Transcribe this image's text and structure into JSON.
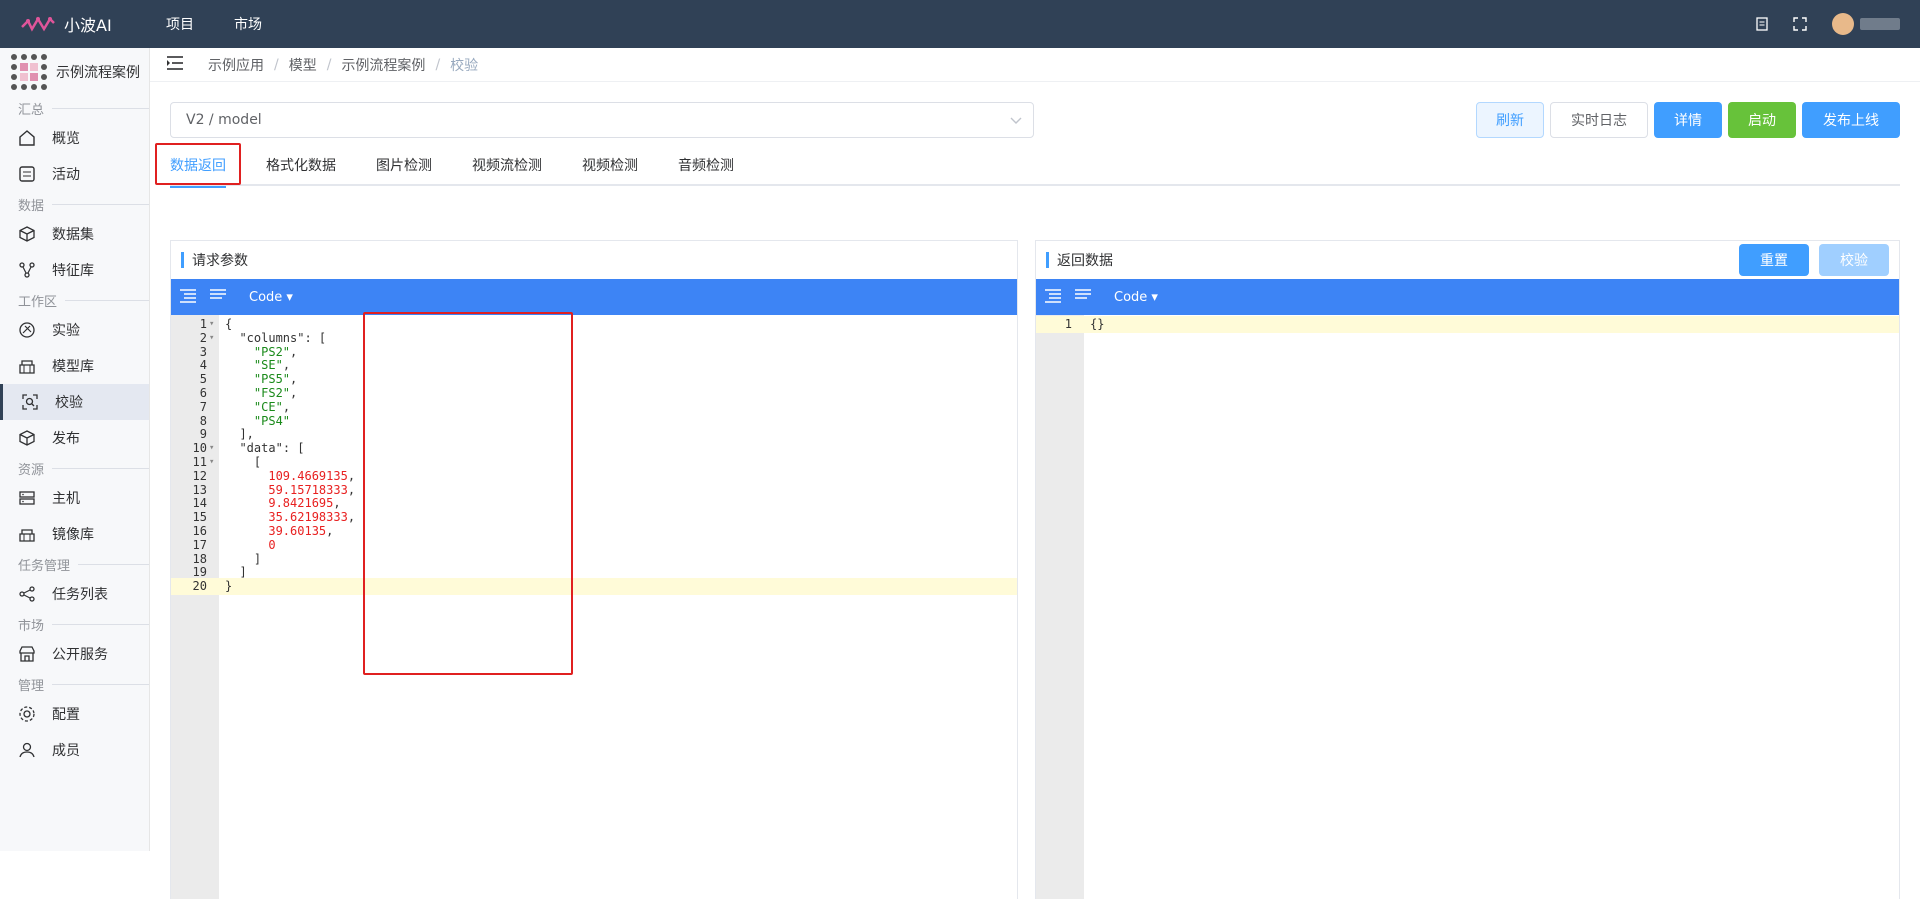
{
  "header": {
    "app_name": "小波AI",
    "nav": [
      "项目",
      "市场"
    ]
  },
  "sidebar": {
    "project_name": "示例流程案例",
    "sections": [
      {
        "title": "汇总",
        "items": [
          {
            "label": "概览",
            "icon": "home-icon"
          },
          {
            "label": "活动",
            "icon": "activity-icon"
          }
        ]
      },
      {
        "title": "数据",
        "items": [
          {
            "label": "数据集",
            "icon": "cube-icon"
          },
          {
            "label": "特征库",
            "icon": "feature-icon"
          }
        ]
      },
      {
        "title": "工作区",
        "items": [
          {
            "label": "实验",
            "icon": "experiment-icon"
          },
          {
            "label": "模型库",
            "icon": "model-icon"
          },
          {
            "label": "校验",
            "icon": "verify-icon",
            "active": true
          },
          {
            "label": "发布",
            "icon": "box-icon"
          }
        ]
      },
      {
        "title": "资源",
        "items": [
          {
            "label": "主机",
            "icon": "server-icon"
          },
          {
            "label": "镜像库",
            "icon": "image-repo-icon"
          }
        ]
      },
      {
        "title": "任务管理",
        "items": [
          {
            "label": "任务列表",
            "icon": "share-icon"
          }
        ]
      },
      {
        "title": "市场",
        "items": [
          {
            "label": "公开服务",
            "icon": "store-icon"
          }
        ]
      },
      {
        "title": "管理",
        "items": [
          {
            "label": "配置",
            "icon": "gear-icon"
          },
          {
            "label": "成员",
            "icon": "user-icon"
          }
        ]
      }
    ]
  },
  "breadcrumb": [
    "示例应用",
    "模型",
    "示例流程案例",
    "校验"
  ],
  "model_select": {
    "value": "V2 / model"
  },
  "actions": {
    "refresh": "刷新",
    "log": "实时日志",
    "detail": "详情",
    "start": "启动",
    "publish": "发布上线"
  },
  "tabs": [
    "数据返回",
    "格式化数据",
    "图片检测",
    "视频流检测",
    "视频检测",
    "音频检测"
  ],
  "request_panel": {
    "title": "请求参数",
    "mode": "Code",
    "lines": [
      "{",
      "  \"columns\": [",
      "    \"PS2\",",
      "    \"SE\",",
      "    \"PS5\",",
      "    \"FS2\",",
      "    \"CE\",",
      "    \"PS4\"",
      "  ],",
      "  \"data\": [",
      "    [",
      "      109.4669135,",
      "      59.15718333,",
      "      9.8421695,",
      "      35.62198333,",
      "      39.60135,",
      "      0",
      "    ]",
      "  ]",
      "}"
    ]
  },
  "response_panel": {
    "title": "返回数据",
    "mode": "Code",
    "reset": "重置",
    "check": "校验",
    "lines": [
      "{}"
    ]
  },
  "colors": {
    "topbar": "#304156",
    "primary": "#409eff",
    "success": "#67c23a",
    "highlight": "#e02020"
  }
}
